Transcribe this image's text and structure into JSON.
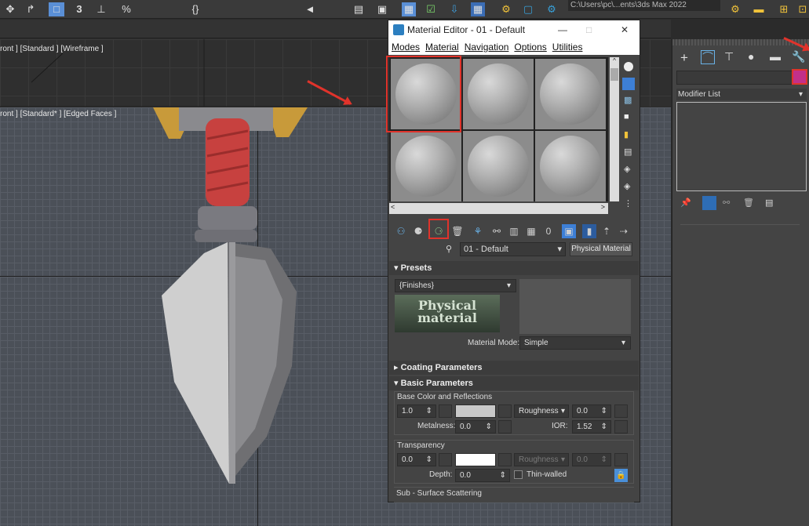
{
  "toolbar": {
    "path_text": "C:\\Users\\pc\\...ents\\3ds Max 2022",
    "icons": [
      "move-icon",
      "snap-icon",
      "mirror-icon",
      "align-icon",
      "layer-icon",
      "curve-editor-icon",
      "schematic-icon",
      "material-editor-icon",
      "render-setup-icon",
      "render-frame-icon",
      "render-icon"
    ]
  },
  "viewport_top": {
    "label": "ront ] [Standard ] [Wireframe ]"
  },
  "viewport_front": {
    "label": "ront ] [Standard* ] [Edged Faces ]"
  },
  "material_editor": {
    "title": "Material Editor - 01 - Default",
    "menu": [
      "Modes",
      "Material",
      "Navigation",
      "Options",
      "Utilities"
    ],
    "material_name": "01 - Default",
    "material_type": "Physical Material",
    "presets": {
      "title": "Presets",
      "dropdown": "{Finishes}",
      "logo_text": "Physical material",
      "mode_label": "Material Mode:",
      "mode_value": "Simple"
    },
    "coating": {
      "title": "Coating Parameters"
    },
    "basic": {
      "title": "Basic Parameters",
      "section_base": "Base Color and Reflections",
      "base_weight": "1.0",
      "base_color": "#c8c8c8",
      "roughness_label": "Roughness",
      "roughness_value": "0.0",
      "metalness_label": "Metalness:",
      "metalness_value": "0.0",
      "ior_label": "IOR:",
      "ior_value": "1.52",
      "section_transparency": "Transparency",
      "transparency_weight": "0.0",
      "transparency_color": "#ffffff",
      "transparency_roughness_label": "Roughness",
      "transparency_roughness_value": "0.0",
      "depth_label": "Depth:",
      "depth_value": "0.0",
      "thin_walled_label": "Thin-walled",
      "section_sss": "Sub - Surface Scattering"
    }
  },
  "command_panel": {
    "modifier_list": "Modifier List",
    "object_color": "#c2308a",
    "tabs": [
      "create-icon",
      "modify-icon",
      "hierarchy-icon",
      "motion-icon",
      "display-icon",
      "utilities-icon"
    ]
  }
}
